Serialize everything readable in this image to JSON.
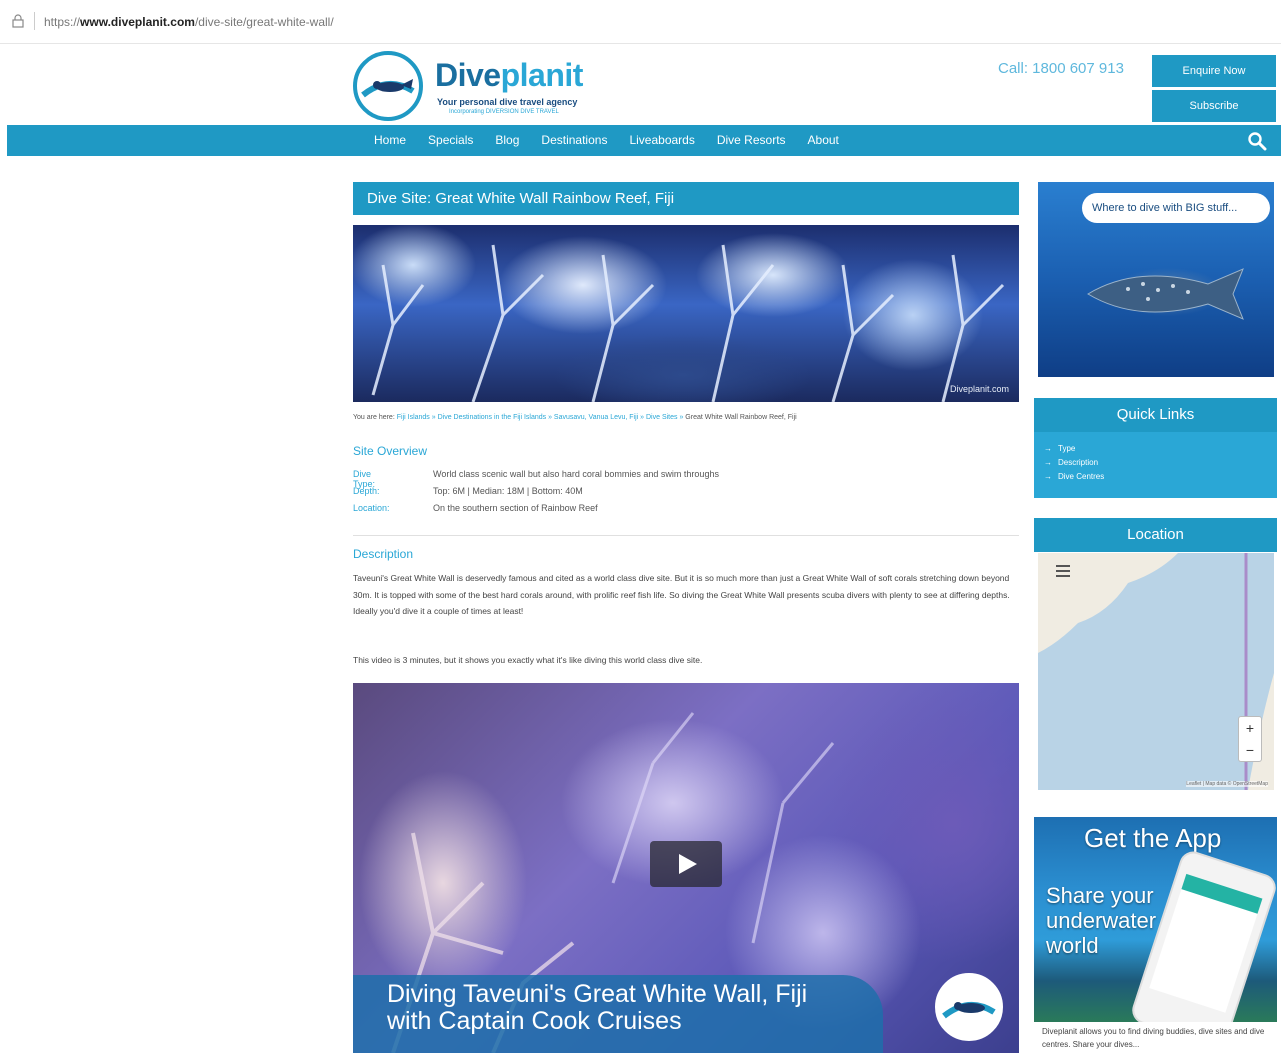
{
  "browser": {
    "url_prefix": "https://",
    "url_domain": "www.diveplanit.com",
    "url_path": "/dive-site/great-white-wall/"
  },
  "header": {
    "logo_name_a": "Dive",
    "logo_name_b": "planit",
    "logo_tagline": "Your personal dive travel agency",
    "logo_subtagline": "Incorporating DIVERSION DIVE TRAVEL",
    "call": "Call: 1800 607 913",
    "enquire_label": "Enquire Now",
    "subscribe_label": "Subscribe"
  },
  "nav": {
    "items": [
      "Home",
      "Specials",
      "Blog",
      "Destinations",
      "Liveaboards",
      "Dive Resorts",
      "About"
    ]
  },
  "main": {
    "title": "Dive Site: Great White Wall Rainbow Reef, Fiji",
    "hero_credit": "Diveplanit.com",
    "breadcrumb": {
      "prefix": "You are here: ",
      "links": "Fiji Islands » Dive Destinations in the Fiji Islands » Savusavu, Vanua Levu, Fiji » Dive Sites » ",
      "current": "Great White Wall Rainbow Reef, Fiji"
    },
    "overview_heading": "Site Overview",
    "overview": [
      {
        "key": "Dive Type:",
        "value": "World class scenic wall but also hard coral bommies and swim throughs"
      },
      {
        "key": "Depth:",
        "value": "Top: 6M | Median: 18M | Bottom: 40M"
      },
      {
        "key": "Location:",
        "value": "On the southern section of Rainbow Reef"
      }
    ],
    "description_heading": "Description",
    "description_p1": "Taveuni's Great White Wall is deservedly famous and cited as a world class dive site. But it is so much more than just a Great White Wall of soft corals stretching down beyond 30m. It is topped with some of the best hard corals around, with prolific reef fish life. So diving the Great White Wall presents scuba divers with plenty to see at differing depths. Ideally you'd dive it a couple of times at least!",
    "description_p2": "This video is 3 minutes, but it shows you exactly what it's like diving this world class dive site.",
    "video_caption_line1": "Diving Taveuni's Great White Wall, Fiji",
    "video_caption_line2": "with Captain Cook Cruises"
  },
  "sidebar": {
    "ad_text": "Where to dive with BIG stuff...",
    "quick_links_title": "Quick Links",
    "quick_links": [
      "Type",
      "Description",
      "Dive Centres"
    ],
    "location_title": "Location",
    "map_zoom_in": "+",
    "map_zoom_out": "−",
    "map_attribution": "Leaflet | Map data © OpenStreetMap",
    "app_title": "Get the App",
    "app_share": "Share your underwater world",
    "app_text": "Diveplanit allows you to find diving buddies, dive sites and dive centres. Share your dives..."
  },
  "colors": {
    "brand": "#1f99c4",
    "brand_light": "#2aa7d6",
    "logo_dark": "#1a6fa0"
  },
  "icons": {
    "lock": "lock-icon",
    "search": "search-icon",
    "play": "play-icon",
    "map_menu": "menu-icon"
  }
}
